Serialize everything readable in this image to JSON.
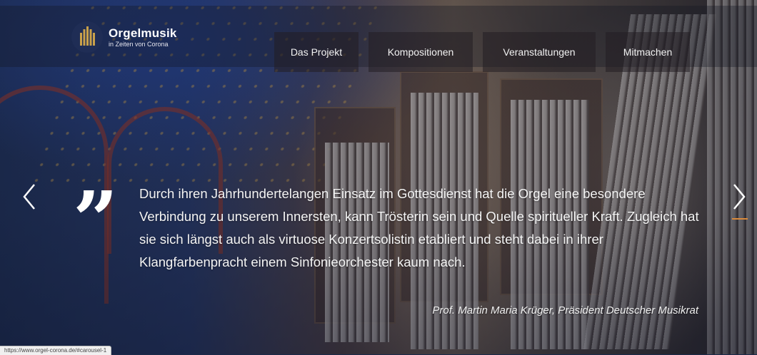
{
  "logo": {
    "title": "Orgelmusik",
    "subtitle": "in Zeiten von Corona"
  },
  "nav": {
    "items": [
      {
        "label": "Das Projekt"
      },
      {
        "label": "Kompositionen"
      },
      {
        "label": "Veranstaltungen"
      },
      {
        "label": "Mitmachen"
      }
    ]
  },
  "carousel": {
    "quote_mark": "”",
    "quote": "Durch ihren Jahrhundertelangen Einsatz im Gottesdienst hat die Orgel eine besondere Verbindung zu unserem Innersten, kann Trösterin sein und Quelle spiritueller Kraft. Zugleich hat sie sich längst auch als virtuose Konzertsolistin etabliert und steht dabei in ihrer Klangfarbenpracht einem Sinfonieorchester kaum nach.",
    "author": "Prof. Martin Maria Krüger, Präsident Deutscher Musikrat",
    "prev_icon": "chevron-left-icon",
    "next_icon": "chevron-right-icon",
    "indicator_color": "#d98a3c"
  },
  "status_url": "https://www.orgel-corona.de/#carousel-1",
  "colors": {
    "accent": "#d98a3c",
    "logo_bg": "#1f2d55",
    "logo_pipes": "#c9a14a"
  }
}
